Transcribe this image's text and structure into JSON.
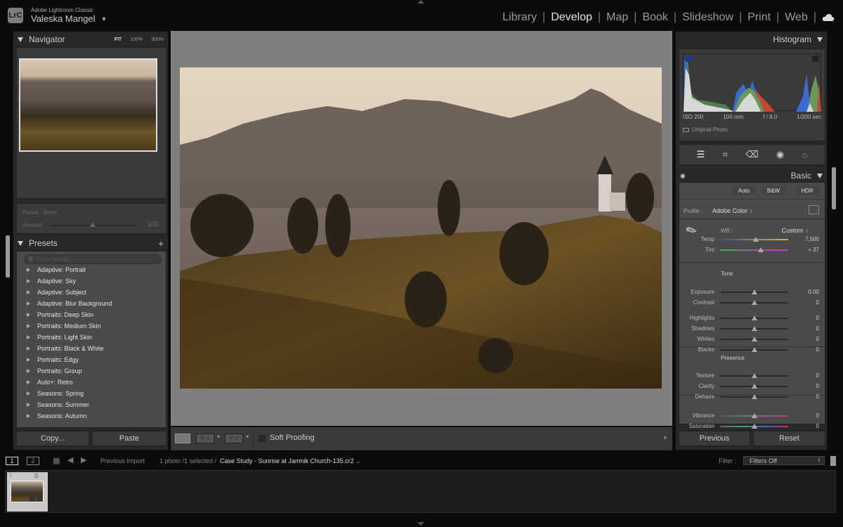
{
  "app": {
    "name": "Adobe Lightroom Classic",
    "logo": "LrC",
    "user": "Valeska Mangel"
  },
  "modules": [
    {
      "label": "Library",
      "active": false
    },
    {
      "label": "Develop",
      "active": true
    },
    {
      "label": "Map",
      "active": false
    },
    {
      "label": "Book",
      "active": false
    },
    {
      "label": "Slideshow",
      "active": false
    },
    {
      "label": "Print",
      "active": false
    },
    {
      "label": "Web",
      "active": false
    }
  ],
  "navigator": {
    "title": "Navigator",
    "zoom": [
      "FIT",
      "100%",
      "300%"
    ]
  },
  "preset_amount": {
    "preset_label": "Preset : None",
    "amount_label": "Amount",
    "amount_value": "100",
    "amount_fraction": 0.5
  },
  "presets": {
    "title": "Presets",
    "filter_placeholder": "Filter Presets",
    "items": [
      "Adaptive: Portrait",
      "Adaptive: Sky",
      "Adaptive: Subject",
      "Adaptive: Blur Background",
      "Portraits: Deep Skin",
      "Portraits: Medium Skin",
      "Portraits: Light Skin",
      "Portraits: Black & White",
      "Portraits: Edgy",
      "Portraits: Group",
      "Auto+: Retro",
      "Seasons: Spring",
      "Seasons: Summer",
      "Seasons: Autumn"
    ]
  },
  "left_buttons": {
    "copy": "Copy...",
    "paste": "Paste"
  },
  "toolbar": {
    "soft_proofing": "Soft Proofing",
    "ra_label": "R A",
    "yy_label": "Y Y"
  },
  "histogram": {
    "title": "Histogram",
    "iso": "ISO 200",
    "focal": "100 mm",
    "aperture": "f / 8.0",
    "shutter": "1/200 sec",
    "original_photo": "Original Photo"
  },
  "basic": {
    "title": "Basic",
    "buttons": [
      "Auto",
      "B&W",
      "HDR"
    ],
    "profile_label": "Profile :",
    "profile_value": "Adobe Color",
    "wb_label": "WB :",
    "wb_value": "Custom",
    "tone_label": "Tone",
    "presence_label": "Presence",
    "sliders": [
      {
        "label": "Temp",
        "value": "7,500",
        "pos": 0.53
      },
      {
        "label": "Tint",
        "value": "+ 37",
        "pos": 0.6
      },
      {
        "label": "Exposure",
        "value": "0.00",
        "pos": 0.5
      },
      {
        "label": "Contrast",
        "value": "0",
        "pos": 0.5
      },
      {
        "label": "Highlights",
        "value": "0",
        "pos": 0.5
      },
      {
        "label": "Shadows",
        "value": "0",
        "pos": 0.5
      },
      {
        "label": "Whites",
        "value": "0",
        "pos": 0.5
      },
      {
        "label": "Blacks",
        "value": "0",
        "pos": 0.5
      },
      {
        "label": "Texture",
        "value": "0",
        "pos": 0.5
      },
      {
        "label": "Clarity",
        "value": "0",
        "pos": 0.5
      },
      {
        "label": "Dehaze",
        "value": "0",
        "pos": 0.5
      },
      {
        "label": "Vibrance",
        "value": "0",
        "pos": 0.5
      },
      {
        "label": "Saturation",
        "value": "0",
        "pos": 0.5
      }
    ]
  },
  "right_buttons": {
    "previous": "Previous",
    "reset": "Reset"
  },
  "filmstrip_bar": {
    "screen1": "1",
    "screen2": "2",
    "source": "Previous Import",
    "count": "1 photo /1 selected /",
    "filename": "Case Study - Sunrise at Jamnik Church-135.cr2",
    "filter_label": "Filter :",
    "filter_value": "Filters Off"
  },
  "filmstrip": {
    "thumb_index": "1"
  }
}
